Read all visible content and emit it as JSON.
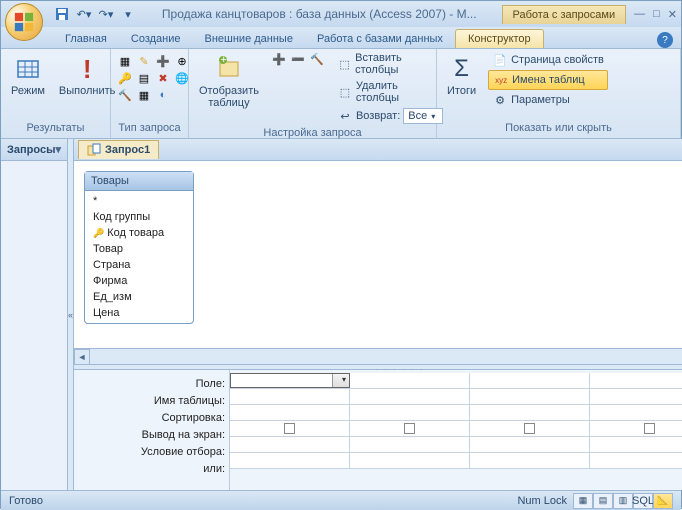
{
  "title": "Продажа канцтоваров : база данных (Access 2007) - M...",
  "context_tab": "Работа с запросами",
  "tabs": {
    "home": "Главная",
    "create": "Создание",
    "external": "Внешние данные",
    "dbtools": "Работа с базами данных",
    "design": "Конструктор"
  },
  "ribbon": {
    "results": {
      "view": "Режим",
      "run": "Выполнить",
      "label": "Результаты"
    },
    "qtype": {
      "label": "Тип запроса"
    },
    "setup": {
      "show_table": "Отобразить\nтаблицу",
      "insert_cols": "Вставить столбцы",
      "delete_cols": "Удалить столбцы",
      "return": "Возврат:",
      "return_val": "Все",
      "label": "Настройка запроса"
    },
    "show": {
      "totals": "Итоги",
      "prop": "Страница свойств",
      "tblnames": "Имена таблиц",
      "params": "Параметры",
      "label": "Показать или скрыть"
    }
  },
  "nav": {
    "header": "Запросы"
  },
  "doc": {
    "tab": "Запрос1"
  },
  "table": {
    "name": "Товары",
    "fields": [
      "*",
      "Код группы",
      "Код товара",
      "Товар",
      "Страна",
      "Фирма",
      "Ед_изм",
      "Цена"
    ],
    "key_index": 2
  },
  "qbe": {
    "labels": [
      "Поле:",
      "Имя таблицы:",
      "Сортировка:",
      "Вывод на экран:",
      "Условие отбора:",
      "или:"
    ]
  },
  "status": {
    "ready": "Готово",
    "numlock": "Num Lock",
    "sql": "SQL"
  }
}
